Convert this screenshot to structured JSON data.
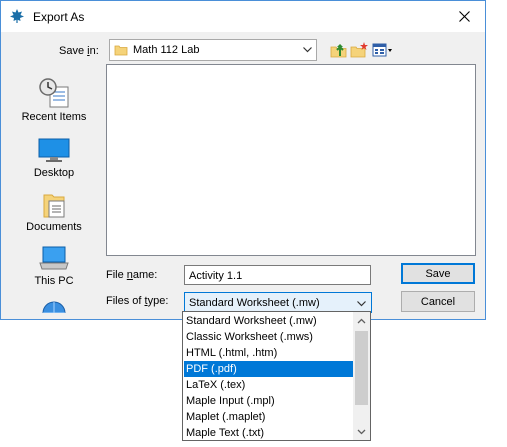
{
  "window": {
    "title": "Export As"
  },
  "save_in": {
    "label_prefix": "Save ",
    "label_mnemonic": "i",
    "label_suffix": "n:",
    "value": "Math 112 Lab"
  },
  "toolbar": {
    "icons": [
      "up-one-level-icon",
      "new-folder-icon",
      "view-menu-icon"
    ]
  },
  "places": [
    {
      "label": "Recent Items",
      "icon": "recent-items-icon"
    },
    {
      "label": "Desktop",
      "icon": "desktop-icon"
    },
    {
      "label": "Documents",
      "icon": "documents-icon"
    },
    {
      "label": "This PC",
      "icon": "this-pc-icon"
    },
    {
      "label": "",
      "icon": "network-icon"
    }
  ],
  "file_name": {
    "label_prefix": "File ",
    "label_mnemonic": "n",
    "label_suffix": "ame:",
    "value": "Activity 1.1"
  },
  "file_type": {
    "label_prefix": "Files of ",
    "label_mnemonic": "t",
    "label_suffix": "ype:",
    "value": "Standard Worksheet (.mw)"
  },
  "buttons": {
    "save": "Save",
    "cancel": "Cancel"
  },
  "dropdown": {
    "options": [
      "Standard Worksheet (.mw)",
      "Classic Worksheet (.mws)",
      "HTML (.html, .htm)",
      "PDF (.pdf)",
      "LaTeX (.tex)",
      "Maple Input (.mpl)",
      "Maplet (.maplet)",
      "Maple Text (.txt)"
    ],
    "selected": "PDF (.pdf)"
  },
  "colors": {
    "selection": "#0078d7",
    "dialog_bg": "#f0f0f0",
    "window_border": "#4a8fd8"
  }
}
